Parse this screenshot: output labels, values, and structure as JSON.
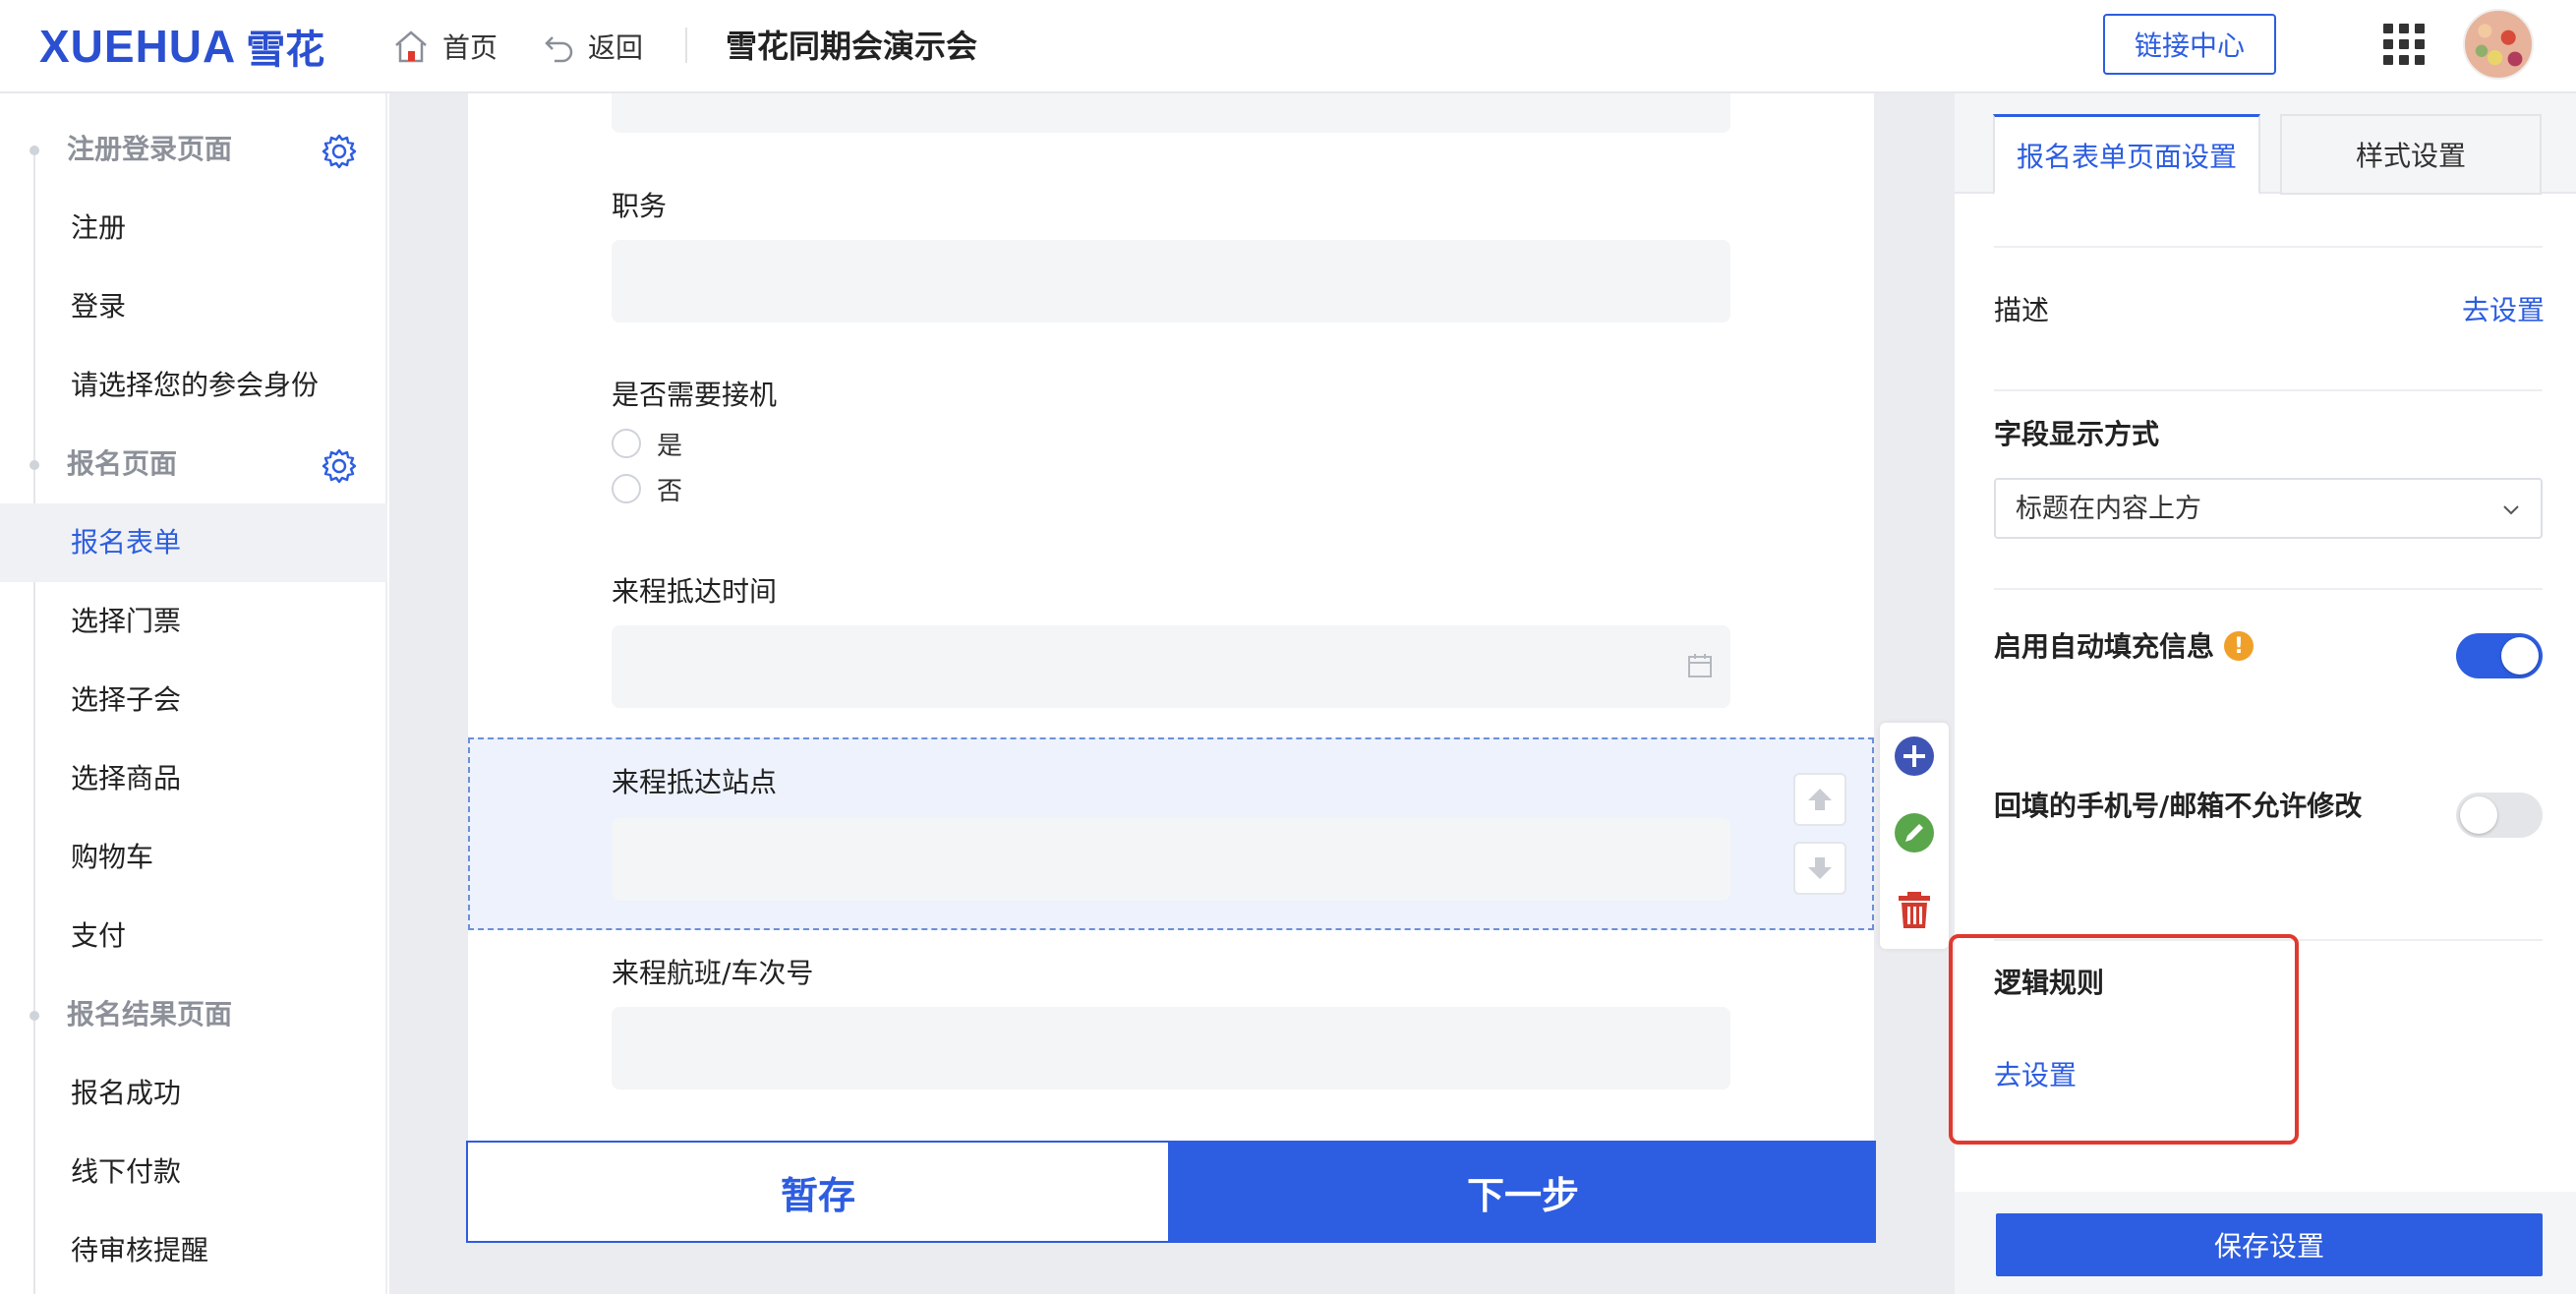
{
  "header": {
    "logo_text": "XUEHUA",
    "logo_cn": "雪花",
    "home_label": "首页",
    "back_label": "返回",
    "event_title": "雪花同期会演示会",
    "link_center_label": "链接中心"
  },
  "sidebar": {
    "groups": [
      {
        "label": "注册登录页面",
        "items": [
          "注册",
          "登录",
          "请选择您的参会身份"
        ]
      },
      {
        "label": "报名页面",
        "items": [
          "报名表单",
          "选择门票",
          "选择子会",
          "选择商品",
          "购物车",
          "支付"
        ]
      },
      {
        "label": "报名结果页面",
        "items": [
          "报名成功",
          "线下付款",
          "待审核提醒"
        ]
      }
    ],
    "active_item": "报名表单"
  },
  "form": {
    "fields": {
      "position": {
        "label": "职务"
      },
      "need_pickup": {
        "label": "是否需要接机",
        "options": [
          "是",
          "否"
        ]
      },
      "arrival_time": {
        "label": "来程抵达时间"
      },
      "arrival_station": {
        "label": "来程抵达站点"
      },
      "arrival_flight": {
        "label": "来程航班/车次号"
      }
    },
    "buttons": {
      "save_draft": "暂存",
      "next": "下一步"
    }
  },
  "right_panel": {
    "tabs": {
      "active": "报名表单页面设置",
      "inactive": "样式设置"
    },
    "description": {
      "label": "描述",
      "link": "去设置"
    },
    "field_display": {
      "label": "字段显示方式",
      "value": "标题在内容上方"
    },
    "autofill": {
      "label": "启用自动填充信息",
      "enabled": true
    },
    "readonly_contact": {
      "label": "回填的手机号/邮箱不允许修改",
      "enabled": false
    },
    "logic_rules": {
      "label": "逻辑规则",
      "link": "去设置"
    },
    "save_button": "保存设置"
  },
  "colors": {
    "primary": "#2d5de0",
    "highlight_border": "#e0392f",
    "warning": "#f0a028",
    "edit_green": "#5aa64b",
    "delete_red": "#d23a2e"
  }
}
